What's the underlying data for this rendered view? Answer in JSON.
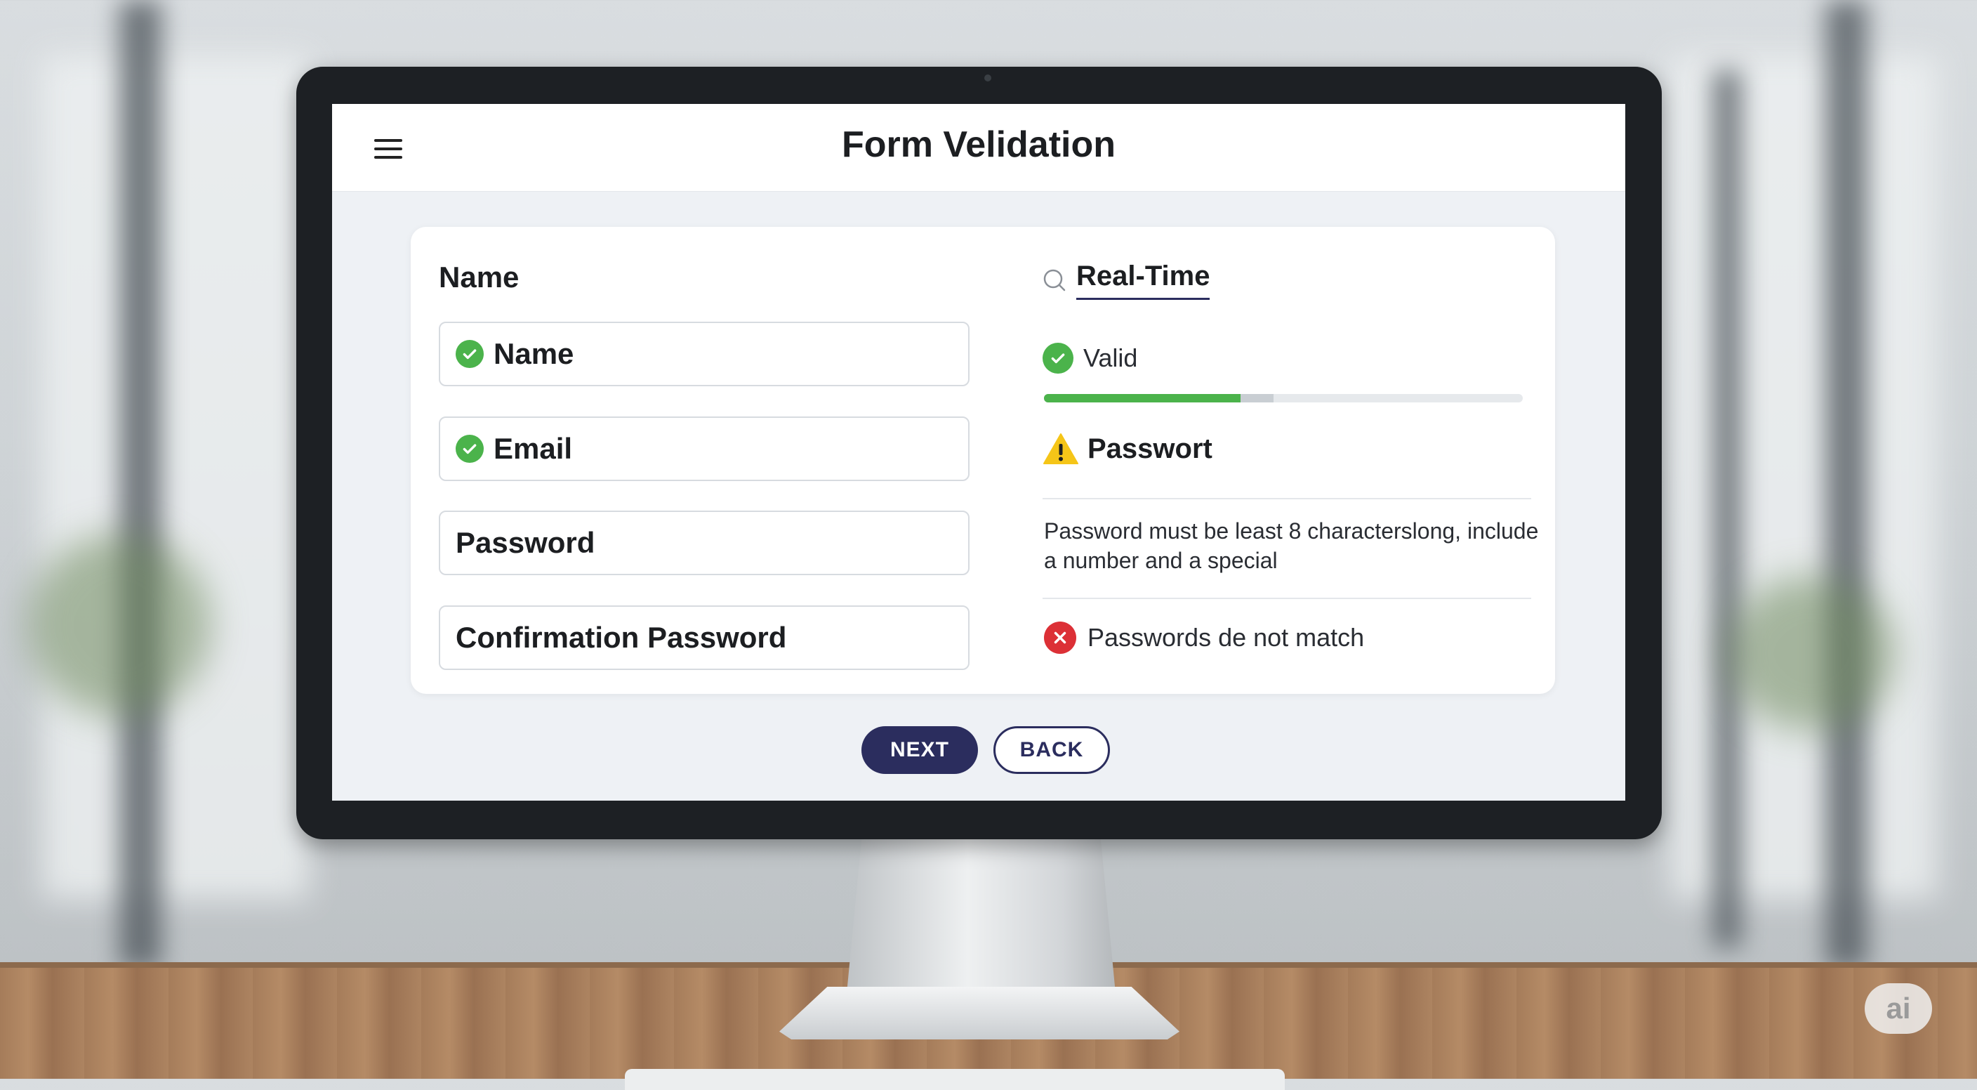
{
  "app": {
    "title": "Form Velidation"
  },
  "form": {
    "section_label": "Name",
    "fields": [
      {
        "label": "Name",
        "status": "valid"
      },
      {
        "label": "Email",
        "status": "valid"
      },
      {
        "label": "Password",
        "status": "none"
      },
      {
        "label": "Confirmation Password",
        "status": "none"
      }
    ]
  },
  "panel": {
    "realtime_label": "Real-Time",
    "valid_text": "Valid",
    "strength_progress": 0.41,
    "strength_secondary": 0.48,
    "warning_label": "Passwort",
    "hint_line1": "Password must be least 8 characterslong, include",
    "hint_line2": "a number and a special",
    "error_text": "Passwords de not match"
  },
  "actions": {
    "next_label": "NEXT",
    "back_label": "BACK"
  },
  "watermark": "ai",
  "colors": {
    "accent": "#2b2d5e",
    "success": "#4bb34b",
    "error": "#dc3036",
    "warning": "#f5c518"
  },
  "icons": {
    "menu": "hamburger-icon",
    "valid": "check-circle-icon",
    "search": "search-icon",
    "warning": "warning-triangle-icon",
    "error": "x-circle-icon"
  }
}
